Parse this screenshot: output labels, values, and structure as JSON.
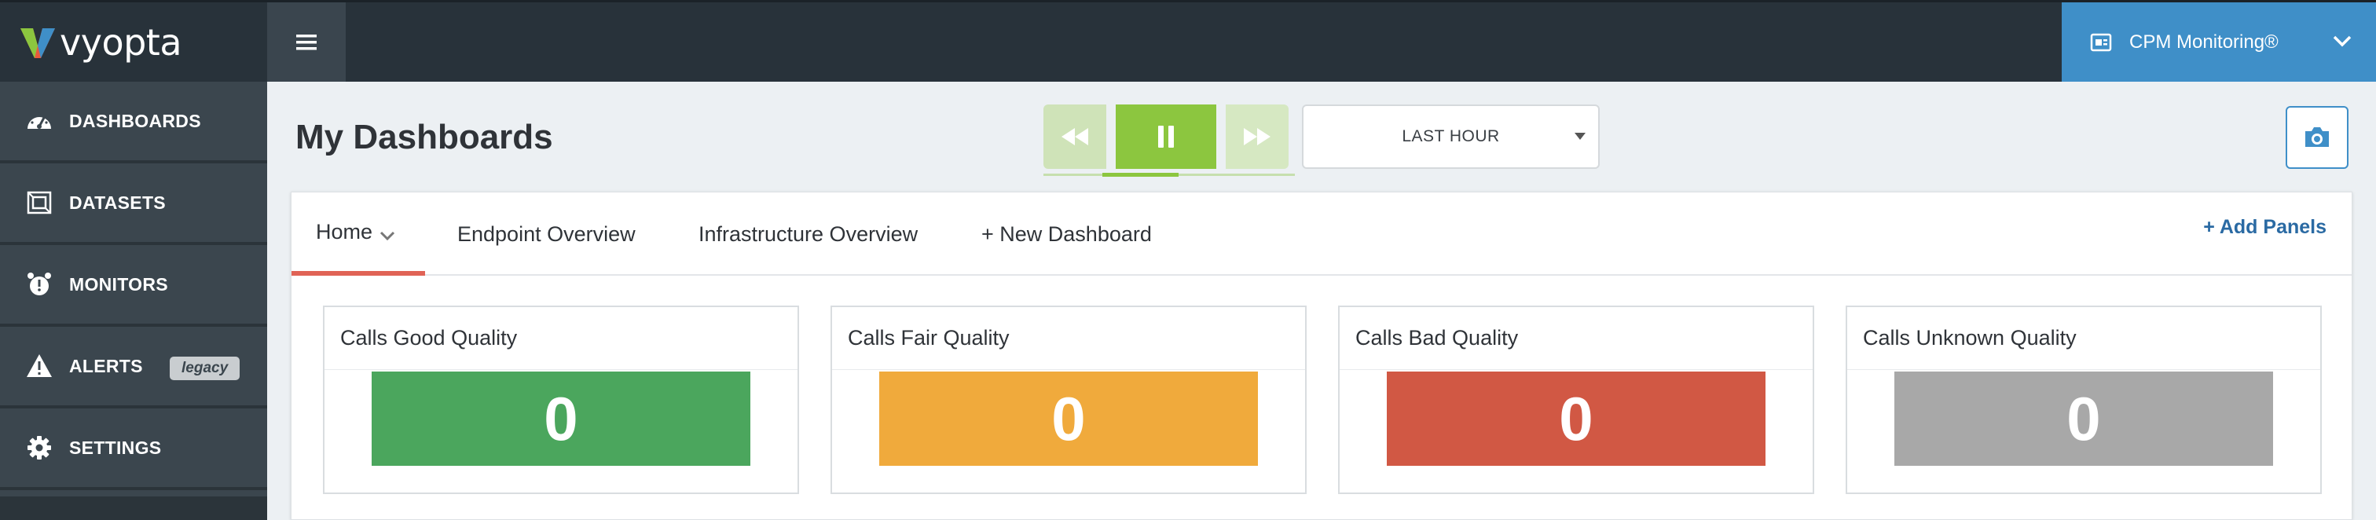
{
  "app": {
    "logo_text": "vyopta",
    "account_label": "CPM Monitoring®"
  },
  "sidebar": {
    "items": [
      {
        "label": "DASHBOARDS",
        "icon": "speedometer-icon"
      },
      {
        "label": "DATASETS",
        "icon": "dataset-icon"
      },
      {
        "label": "MONITORS",
        "icon": "alarm-clock-icon"
      },
      {
        "label": "ALERTS",
        "icon": "warning-icon",
        "badge": "legacy"
      },
      {
        "label": "SETTINGS",
        "icon": "gear-icon"
      }
    ]
  },
  "header": {
    "page_title": "My Dashboards",
    "time_range": "LAST HOUR",
    "playback_progress": 0.3
  },
  "tabs": [
    {
      "label": "Home",
      "active": true
    },
    {
      "label": "Endpoint Overview"
    },
    {
      "label": "Infrastructure Overview"
    },
    {
      "label": "+ New Dashboard"
    }
  ],
  "add_panels_label": "+ Add Panels",
  "panels": [
    {
      "title": "Calls Good Quality",
      "value": "0",
      "color": "#4ba65d"
    },
    {
      "title": "Calls Fair Quality",
      "value": "0",
      "color": "#f0aa3c"
    },
    {
      "title": "Calls Bad Quality",
      "value": "0",
      "color": "#d15844"
    },
    {
      "title": "Calls Unknown Quality",
      "value": "0",
      "color": "#a8a8a8"
    }
  ],
  "colors": {
    "topbar": "#28323a",
    "sidebar": "#3b464e",
    "accent_blue": "#3f8fc8",
    "play_green": "#8cc63f",
    "active_tab": "#e06356"
  }
}
